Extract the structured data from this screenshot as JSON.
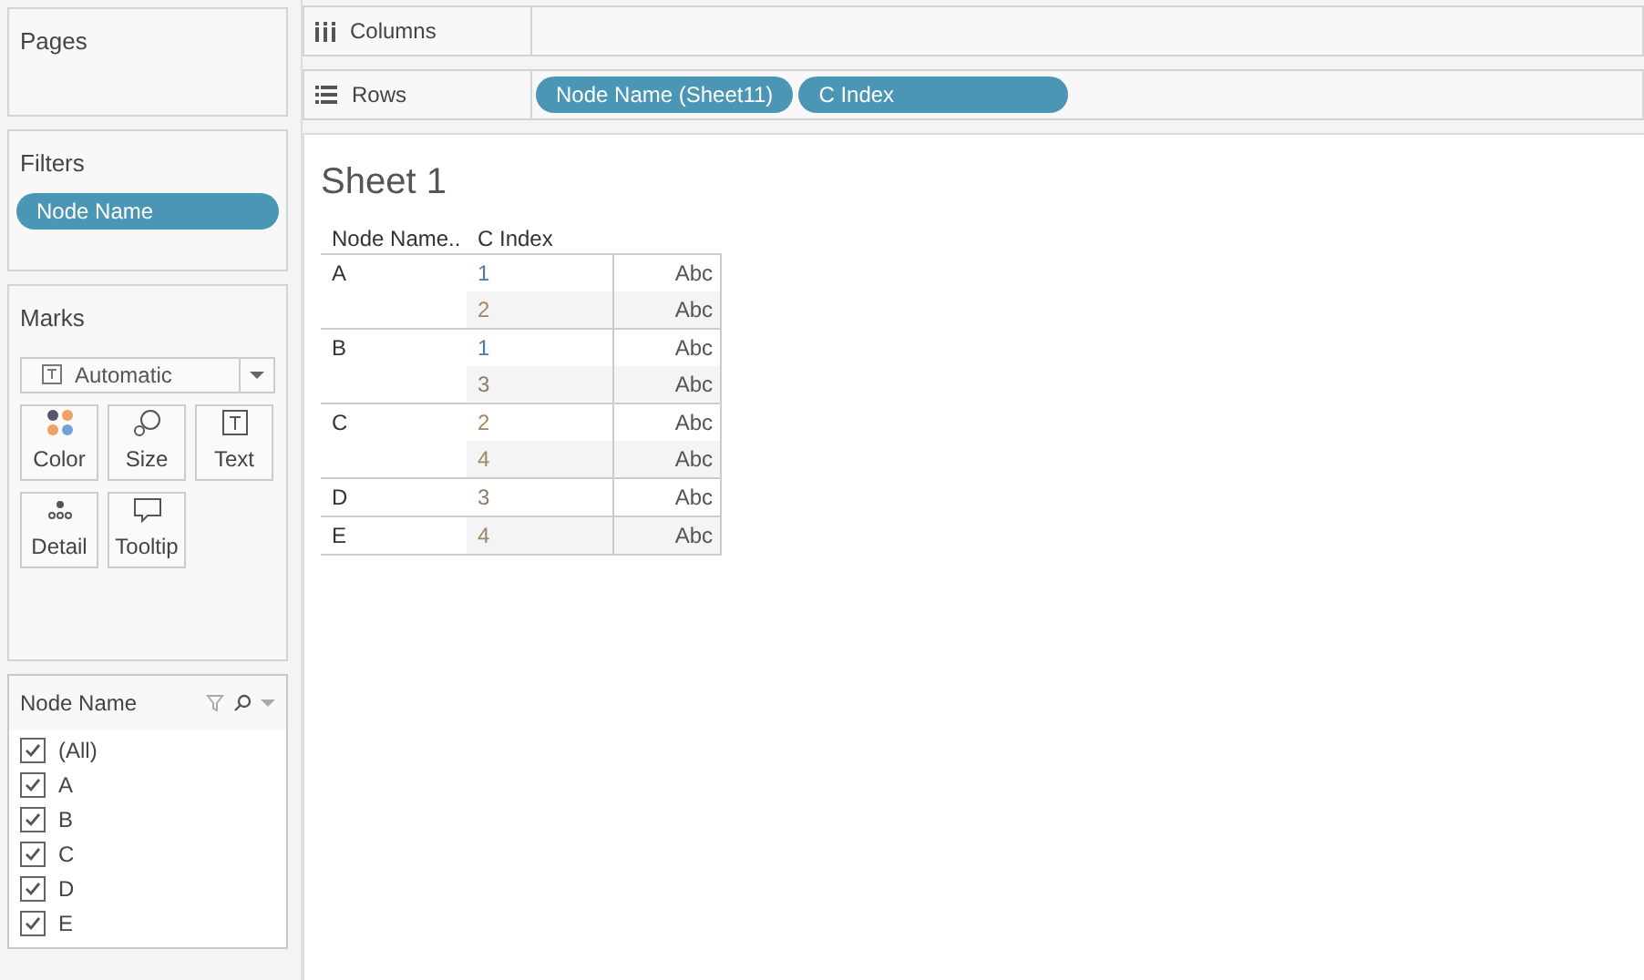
{
  "pages": {
    "title": "Pages"
  },
  "filters": {
    "title": "Filters",
    "pills": [
      "Node Name"
    ]
  },
  "marks": {
    "title": "Marks",
    "mark_type": "Automatic",
    "cards": [
      {
        "kind": "color",
        "label": "Color"
      },
      {
        "kind": "size",
        "label": "Size"
      },
      {
        "kind": "text",
        "label": "Text"
      },
      {
        "kind": "detail",
        "label": "Detail"
      },
      {
        "kind": "tooltip",
        "label": "Tooltip"
      }
    ]
  },
  "filter_card": {
    "title": "Node Name",
    "items": [
      {
        "label": "(All)",
        "checked": true
      },
      {
        "label": "A",
        "checked": true
      },
      {
        "label": "B",
        "checked": true
      },
      {
        "label": "C",
        "checked": true
      },
      {
        "label": "D",
        "checked": true
      },
      {
        "label": "E",
        "checked": true
      }
    ]
  },
  "columns_shelf": {
    "label": "Columns"
  },
  "rows_shelf": {
    "label": "Rows",
    "pills": [
      "Node Name (Sheet11)",
      "C Index"
    ]
  },
  "sheet": {
    "title": "Sheet 1",
    "columns": [
      "Node Name..",
      "C Index"
    ],
    "groups": [
      {
        "node": "A",
        "rows": [
          {
            "index": "1",
            "color": "#4e79a7",
            "value": "Abc"
          },
          {
            "index": "2",
            "color": "#a8875a",
            "value": "Abc"
          }
        ]
      },
      {
        "node": "B",
        "rows": [
          {
            "index": "1",
            "color": "#4e79a7",
            "value": "Abc"
          },
          {
            "index": "3",
            "color": "#8c7b68",
            "value": "Abc"
          }
        ]
      },
      {
        "node": "C",
        "rows": [
          {
            "index": "2",
            "color": "#a8875a",
            "value": "Abc"
          },
          {
            "index": "4",
            "color": "#9a8866",
            "value": "Abc"
          }
        ]
      },
      {
        "node": "D",
        "rows": [
          {
            "index": "3",
            "color": "#8c7b68",
            "value": "Abc"
          }
        ]
      },
      {
        "node": "E",
        "rows": [
          {
            "index": "4",
            "color": "#9a8866",
            "value": "Abc"
          }
        ]
      }
    ]
  }
}
